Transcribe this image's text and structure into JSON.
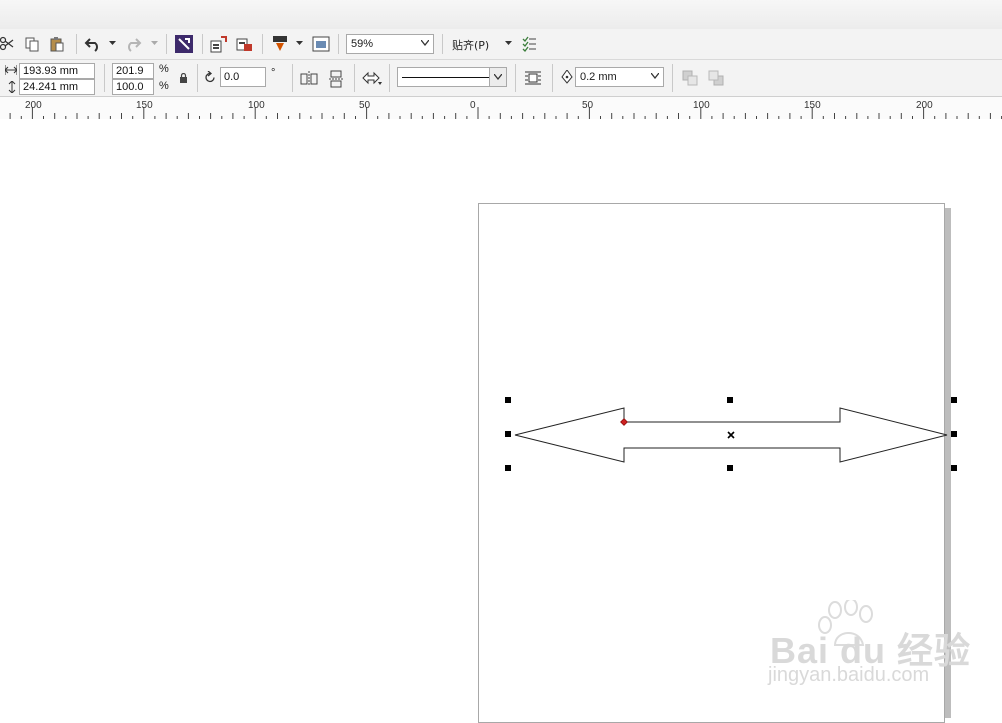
{
  "toolbar_standard": {
    "zoom_value": "59%",
    "snap_label": "贴齐(P)"
  },
  "property_bar": {
    "width_value": "193.93 mm",
    "height_value": "24.241 mm",
    "scale_x_value": "201.9",
    "scale_y_value": "100.0",
    "percent_symbol": "%",
    "rotation_value": "0.0",
    "degree_symbol": "°",
    "outline_width_value": "0.2 mm"
  },
  "ruler": {
    "labels": [
      "200",
      "150",
      "100",
      "50",
      "0",
      "50",
      "100",
      "150",
      "200"
    ]
  },
  "watermark": {
    "logo_text": "Bai du 经验",
    "url_text": "jingyan.baidu.com"
  },
  "colors": {
    "toolbar_bg": "#f3f3f3",
    "page_border": "#a8a8a8",
    "node_red": "#cc2222"
  }
}
